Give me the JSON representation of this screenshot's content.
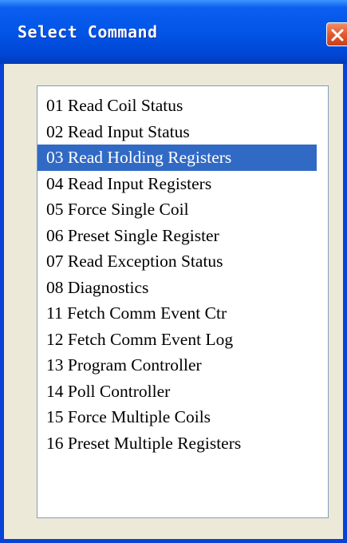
{
  "window": {
    "title": "Select Command"
  },
  "commands": {
    "items": [
      {
        "label": "01 Read Coil Status"
      },
      {
        "label": "02 Read Input Status"
      },
      {
        "label": "03 Read Holding Registers"
      },
      {
        "label": "04 Read Input Registers"
      },
      {
        "label": "05 Force Single Coil"
      },
      {
        "label": "06 Preset Single Register"
      },
      {
        "label": "07 Read Exception Status"
      },
      {
        "label": "08 Diagnostics"
      },
      {
        "label": "11 Fetch Comm Event Ctr"
      },
      {
        "label": "12 Fetch Comm Event Log"
      },
      {
        "label": "13 Program Controller"
      },
      {
        "label": "14 Poll Controller"
      },
      {
        "label": "15 Force Multiple Coils"
      },
      {
        "label": "16 Preset Multiple Registers"
      }
    ],
    "selected": "03 Read Holding Registers"
  },
  "icons": {
    "close": "close-icon"
  },
  "colors": {
    "titlebar": "#0255e6",
    "selection": "#316ac5",
    "close_button": "#e15a2f",
    "dialog_background": "#ece9d8"
  }
}
